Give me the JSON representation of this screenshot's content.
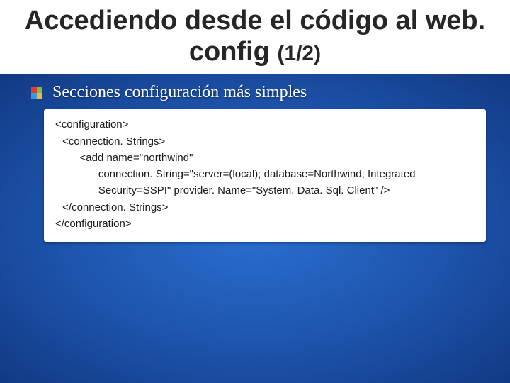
{
  "slide": {
    "title_main": "Accediendo desde el código al web. config",
    "title_part": "(1/2)",
    "subtitle": "Secciones configuración más simples",
    "code_lines": [
      "<configuration>",
      " <connection. Strings>",
      "   <add name=\"northwind\"",
      "     connection. String=\"server=(local); database=Northwind; Integrated",
      "     Security=SSPI\" provider. Name=\"System. Data. Sql. Client\" />",
      " </connection. Strings>",
      "</configuration>"
    ]
  }
}
